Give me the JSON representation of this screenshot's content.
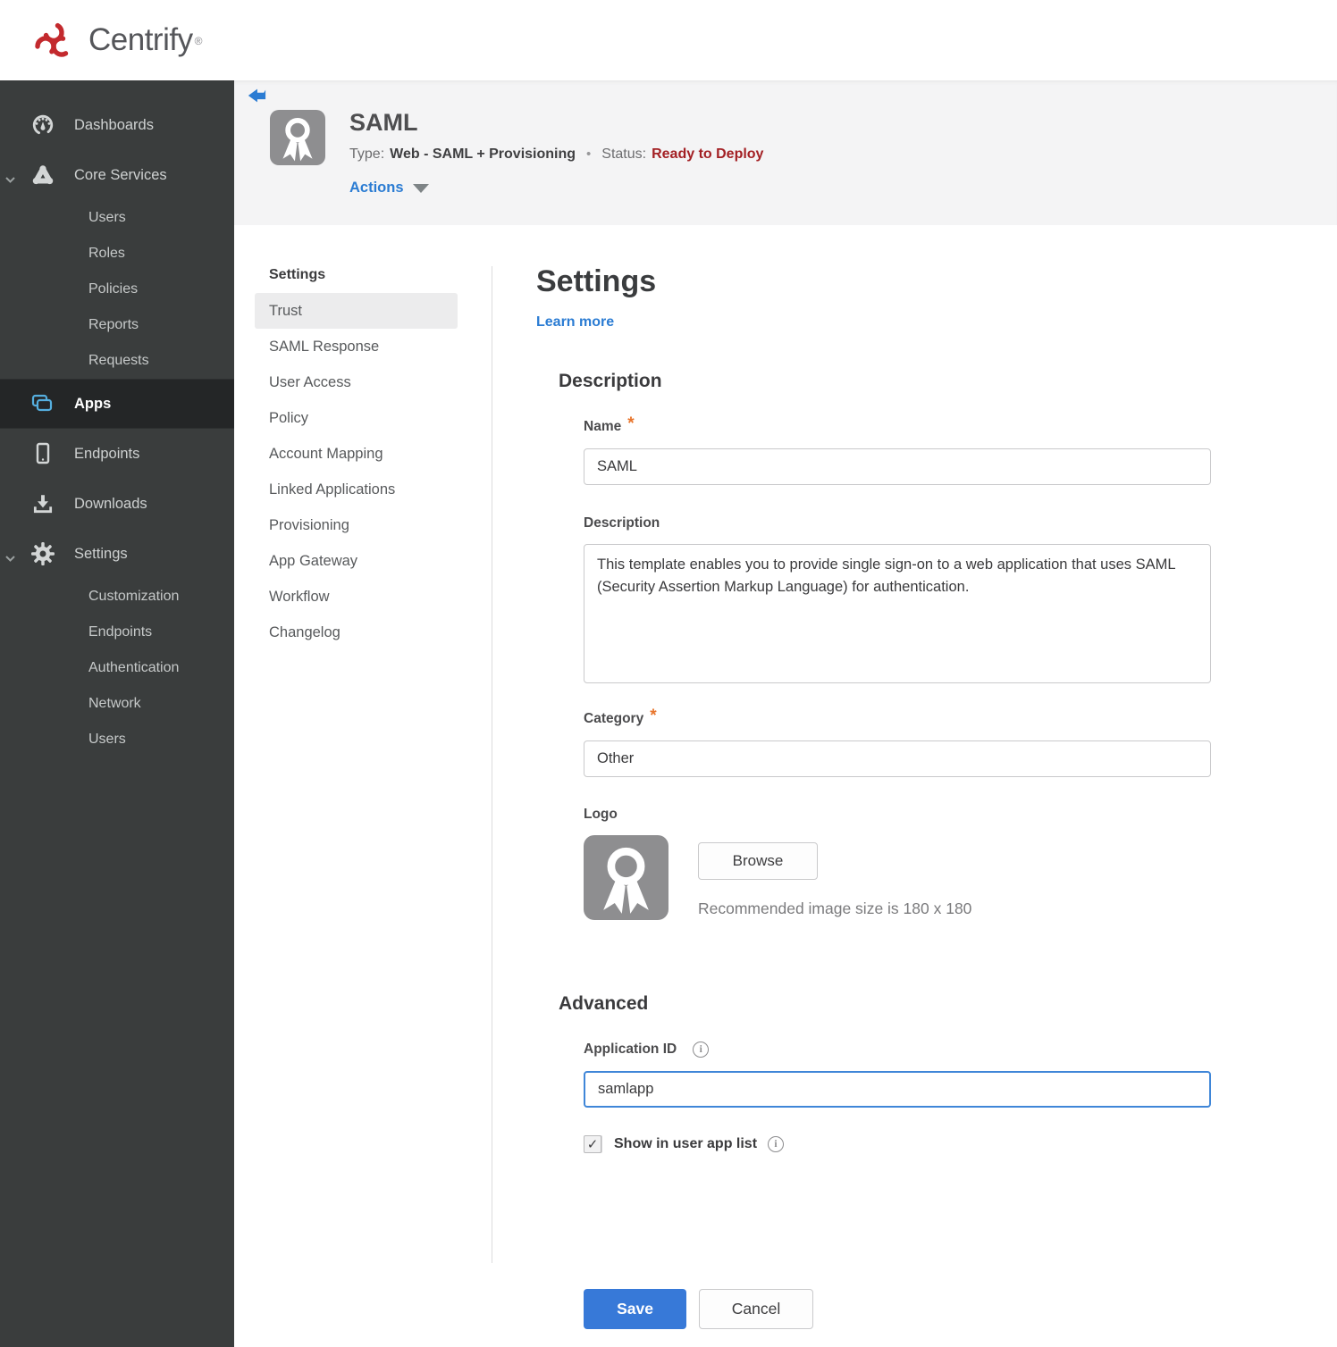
{
  "brand": {
    "name": "Centrify",
    "trademark_symbol": "®"
  },
  "glyphs": {
    "info": "i",
    "check": "✓",
    "required_marker": "*"
  },
  "colors": {
    "link_blue": "#2b7cd3",
    "status_red": "#a32024",
    "save_blue": "#3779d8",
    "apps_icon_cyan": "#55aede",
    "sidebar_bg": "#3a3d3d",
    "header_band_bg": "#f4f4f5"
  },
  "sidebar": {
    "items": [
      {
        "label": "Dashboards"
      },
      {
        "label": "Core Services"
      },
      {
        "label": "Users"
      },
      {
        "label": "Roles"
      },
      {
        "label": "Policies"
      },
      {
        "label": "Reports"
      },
      {
        "label": "Requests"
      },
      {
        "label": "Apps"
      },
      {
        "label": "Endpoints"
      },
      {
        "label": "Downloads"
      },
      {
        "label": "Settings"
      },
      {
        "label": "Customization"
      },
      {
        "label": "Endpoints"
      },
      {
        "label": "Authentication"
      },
      {
        "label": "Network"
      },
      {
        "label": "Users"
      }
    ]
  },
  "header": {
    "app_name": "SAML",
    "type_label": "Type:",
    "type_value": "Web - SAML + Provisioning",
    "separator": "•",
    "status_label": "Status:",
    "status_value": "Ready to Deploy",
    "actions_label": "Actions"
  },
  "subnav": {
    "header": "Settings",
    "active_item": "Trust",
    "items": [
      "Trust",
      "SAML Response",
      "User Access",
      "Policy",
      "Account Mapping",
      "Linked Applications",
      "Provisioning",
      "App Gateway",
      "Workflow",
      "Changelog"
    ]
  },
  "main": {
    "title": "Settings",
    "learn_more_label": "Learn more",
    "description_section": {
      "heading": "Description",
      "name_label": "Name",
      "name_value": "SAML",
      "description_label": "Description",
      "description_value": "This template enables you to provide single sign-on to a web application that uses SAML (Security Assertion Markup Language) for authentication.",
      "category_label": "Category",
      "category_value": "Other",
      "logo_label": "Logo",
      "browse_label": "Browse",
      "logo_hint": "Recommended image size is 180 x 180"
    },
    "advanced_section": {
      "heading": "Advanced",
      "application_id_label": "Application ID",
      "application_id_value": "samlapp",
      "show_in_app_list_label": "Show in user app list",
      "show_in_app_list_checked": true
    },
    "footer": {
      "save_label": "Save",
      "cancel_label": "Cancel"
    }
  }
}
